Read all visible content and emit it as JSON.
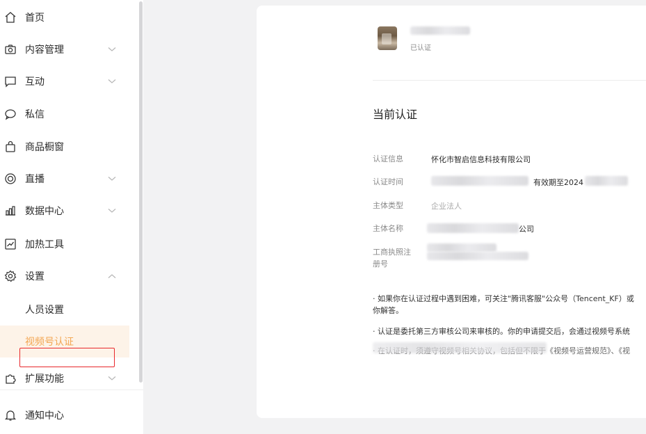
{
  "sidebar": {
    "items": [
      {
        "label": "首页",
        "icon": "home-icon"
      },
      {
        "label": "内容管理",
        "icon": "camera-icon"
      },
      {
        "label": "互动",
        "icon": "message-box-icon"
      },
      {
        "label": "私信",
        "icon": "chat-bubble-icon"
      },
      {
        "label": "商品橱窗",
        "icon": "shopping-bag-icon"
      },
      {
        "label": "直播",
        "icon": "live-icon"
      },
      {
        "label": "数据中心",
        "icon": "bar-chart-icon"
      },
      {
        "label": "加热工具",
        "icon": "trend-icon"
      },
      {
        "label": "设置",
        "icon": "gear-icon"
      },
      {
        "label": "人员设置"
      },
      {
        "label": "视频号认证"
      },
      {
        "label": "扩展功能",
        "icon": "puzzle-icon"
      },
      {
        "label": "通知中心",
        "icon": "bell-icon"
      }
    ],
    "active_color": "#f3a652"
  },
  "profile": {
    "status": "已认证"
  },
  "certification": {
    "title": "当前认证",
    "rows": [
      {
        "label": "认证信息",
        "value": "怀化市智启信息科技有限公司"
      },
      {
        "label": "认证时间",
        "value_suffix": "有效期至2024"
      },
      {
        "label": "主体类型",
        "value": "企业法人"
      },
      {
        "label": "主体名称",
        "value_suffix": "公司"
      },
      {
        "label": "工商执照注册号"
      }
    ],
    "notes": [
      "· 如果你在认证过程中遇到困难，可关注\"腾讯客服\"公众号（Tencent_KF）或",
      "你解答。",
      "· 认证是委托第三方审核公司来审核的。你的申请提交后，会通过视频号系统",
      "· 在认证时，须遵守视频号相关协议，包括但不限于《视频号运营规范》、《视"
    ]
  }
}
